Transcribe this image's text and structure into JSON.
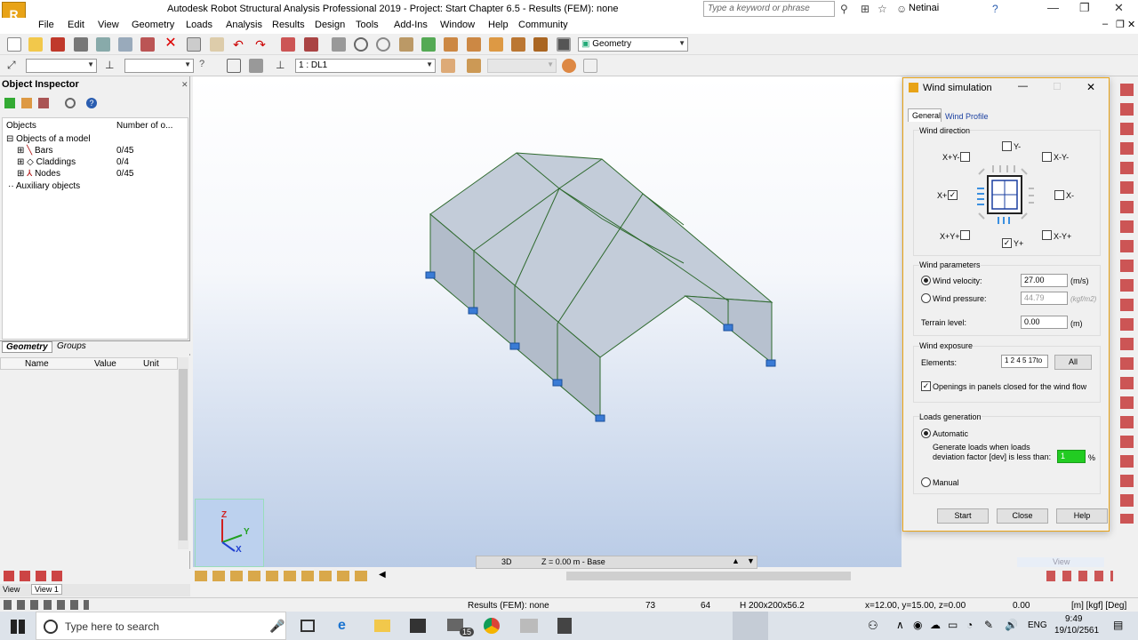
{
  "title_bar": {
    "app_title": "Autodesk Robot Structural Analysis Professional 2019 - Project: Start Chapter 6.5 - Results (FEM): none",
    "search_placeholder": "Type a keyword or phrase",
    "user": "Netinai",
    "logo_text": "R",
    "logo_sub": "PRO"
  },
  "menu": [
    "File",
    "Edit",
    "View",
    "Geometry",
    "Loads",
    "Analysis",
    "Results",
    "Design",
    "Tools",
    "Add-Ins",
    "Window",
    "Help",
    "Community"
  ],
  "toolbar": {
    "layout_select": "Geometry",
    "case_select": "1 : DL1"
  },
  "inspector": {
    "title": "Object Inspector",
    "col_objects": "Objects",
    "col_number": "Number of o...",
    "root": "Objects of a model",
    "items": [
      {
        "label": "Bars",
        "count": "0/45"
      },
      {
        "label": "Claddings",
        "count": "0/4"
      },
      {
        "label": "Nodes",
        "count": "0/45"
      }
    ],
    "aux": "Auxiliary objects",
    "tab_geometry": "Geometry",
    "tab_groups": "Groups",
    "prop_cols": [
      "Name",
      "Value",
      "Unit"
    ]
  },
  "viewport": {
    "mode": "3D",
    "plane": "Z = 0.00 m - Base",
    "axis_labels": [
      "Z",
      "Y",
      "X"
    ],
    "view_label": "View"
  },
  "bottom_tabs": [
    "View",
    "View 1"
  ],
  "status": {
    "results": "Results (FEM): none",
    "n1": "73",
    "n2": "64",
    "section": "H 200x200x56.2",
    "coords": "x=12.00, y=15.00, z=0.00",
    "angle": "0.00",
    "units": "[m] [kgf] [Deg]"
  },
  "dialog": {
    "title": "Wind simulation",
    "tabs": [
      "General",
      "Wind Profile"
    ],
    "wind_direction": {
      "label": "Wind direction",
      "dirs": [
        {
          "label": "Y-",
          "checked": false
        },
        {
          "label": "X+Y-",
          "checked": false
        },
        {
          "label": "X-Y-",
          "checked": false
        },
        {
          "label": "X+",
          "checked": true
        },
        {
          "label": "X-",
          "checked": false
        },
        {
          "label": "X+Y+",
          "checked": false
        },
        {
          "label": "Y+",
          "checked": true
        },
        {
          "label": "X-Y+",
          "checked": false
        }
      ]
    },
    "wind_params": {
      "label": "Wind parameters",
      "velocity_label": "Wind velocity:",
      "velocity": "27.00",
      "velocity_unit": "(m/s)",
      "pressure_label": "Wind pressure:",
      "pressure": "44.79",
      "pressure_unit": "(kgf/m2)",
      "terrain_label": "Terrain level:",
      "terrain": "0.00",
      "terrain_unit": "(m)"
    },
    "exposure": {
      "label": "Wind exposure",
      "elements_label": "Elements:",
      "elements": "1 2 4 5 17to",
      "all_btn": "All",
      "openings": "Openings in panels closed for the wind flow"
    },
    "loads_gen": {
      "label": "Loads generation",
      "automatic": "Automatic",
      "desc1": "Generate loads when loads",
      "desc2": "deviation factor [dev] is less than:",
      "dev": "1",
      "dev_unit": "%",
      "manual": "Manual"
    },
    "buttons": {
      "start": "Start",
      "close": "Close",
      "help": "Help"
    }
  },
  "taskbar": {
    "search": "Type here to search",
    "lang": "ENG",
    "time": "9:49",
    "date": "19/10/2561",
    "badge": "15"
  },
  "colors": {
    "accent": "#e8a317",
    "viewport_sky": "#b9cbe6",
    "model_fill": "#c3ccd9",
    "model_edge": "#2f6a2f",
    "support": "#3a7bd5",
    "dev_field": "#22cc22"
  }
}
